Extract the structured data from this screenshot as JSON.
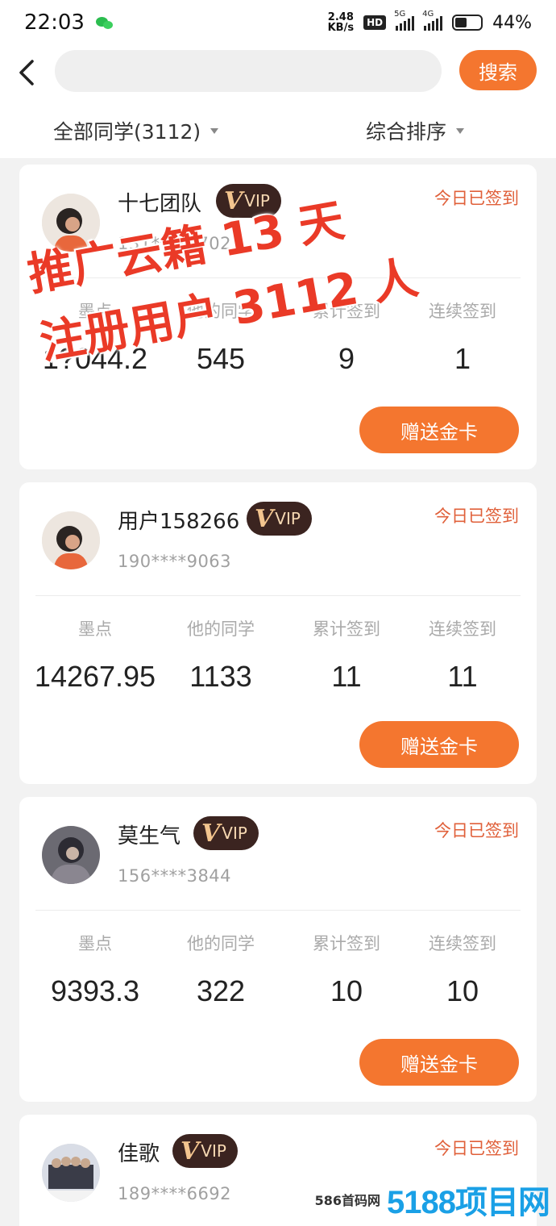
{
  "status_bar": {
    "time": "22:03",
    "net_speed_value": "2.48",
    "net_speed_unit": "KB/s",
    "hd_label": "HD",
    "signal_1_label": "5G",
    "signal_2_label": "4G",
    "battery": "44%",
    "battery_level": 0.44,
    "notification_icon": "wechat-icon"
  },
  "header": {
    "search_placeholder": "",
    "search_button_label": "搜索",
    "filter_left_label": "全部同学(3112)",
    "filter_right_label": "综合排序"
  },
  "stat_labels": [
    "墨点",
    "他的同学",
    "累计签到",
    "连续签到"
  ],
  "cards": [
    {
      "name": "十七团队",
      "vip": "VIP",
      "vip_v": "V",
      "phone": "131****8702",
      "signed": "今日已签到",
      "stats": [
        "1?044.2",
        "545",
        "9",
        "1"
      ],
      "gift_label": "赠送金卡"
    },
    {
      "name": "用户158266",
      "vip": "VIP",
      "vip_v": "V",
      "phone": "190****9063",
      "signed": "今日已签到",
      "stats": [
        "14267.95",
        "1133",
        "11",
        "11"
      ],
      "gift_label": "赠送金卡"
    },
    {
      "name": "莫生气",
      "vip": "VIP",
      "vip_v": "V",
      "phone": "156****3844",
      "signed": "今日已签到",
      "stats": [
        "9393.3",
        "322",
        "10",
        "10"
      ],
      "gift_label": "赠送金卡"
    },
    {
      "name": "佳歌",
      "vip": "VIP",
      "vip_v": "V",
      "phone": "189****6692",
      "signed": "今日已签到"
    }
  ],
  "overlay": {
    "line1": "推广云籍 13 天",
    "line2": "注册用户 3112 人"
  },
  "watermark": {
    "small": "586首码网",
    "big": "5188项目网"
  },
  "colors": {
    "accent": "#f4762f",
    "signed_text": "#e0603a",
    "vip_bg": "#3b2420",
    "vip_text": "#f6d8b2",
    "overlay_text": "#ea3a27"
  }
}
